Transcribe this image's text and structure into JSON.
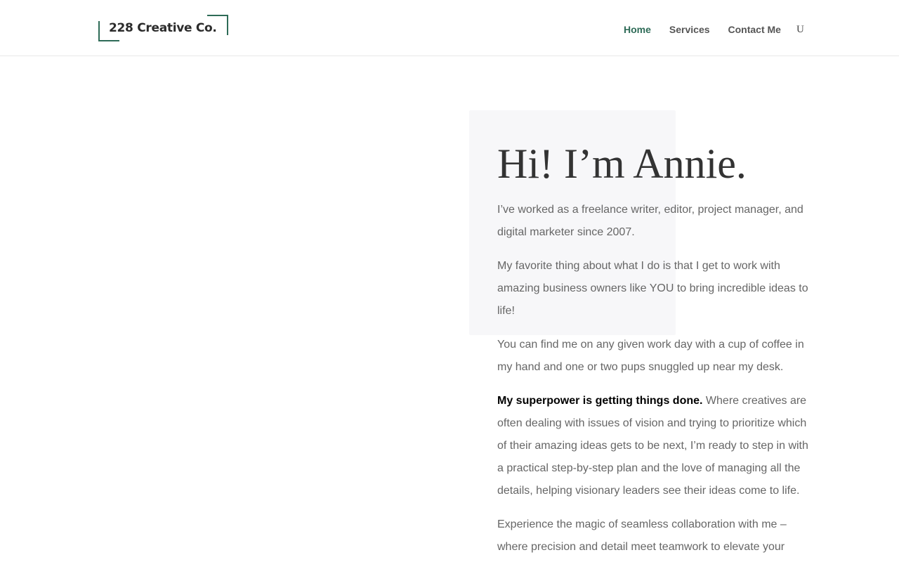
{
  "header": {
    "logo_text": "228 Creative Co.",
    "nav": [
      {
        "label": "Home",
        "active": true
      },
      {
        "label": "Services",
        "active": false
      },
      {
        "label": "Contact Me",
        "active": false
      }
    ],
    "search_glyph": "U"
  },
  "main": {
    "headline": "Hi! I’m Annie.",
    "paragraphs": [
      "I’ve worked as a freelance writer, editor, project manager, and digital marketer since 2007.",
      "My favorite thing about what I do is that I get to work with amazing business owners like YOU to bring incredible ideas to life!",
      "You can find me on any given work day with a cup of coffee in my hand and one or two pups snuggled up near my desk."
    ],
    "superpower": {
      "bold": "My superpower is getting things done.",
      "rest": " Where creatives are often dealing with issues of vision and trying to prioritize which of their amazing ideas gets to be next, I’m ready to step in with a practical step-by-step plan and the love of managing all the details, helping visionary leaders see their ideas come to life."
    },
    "closing": "Experience the magic of seamless collaboration with me – where precision and detail meet teamwork to elevate your"
  },
  "colors": {
    "accent": "#2e6b57",
    "text": "#666666",
    "heading": "#333333",
    "box_bg": "#f7f7f9"
  },
  "icons": {
    "search": "search-icon"
  }
}
